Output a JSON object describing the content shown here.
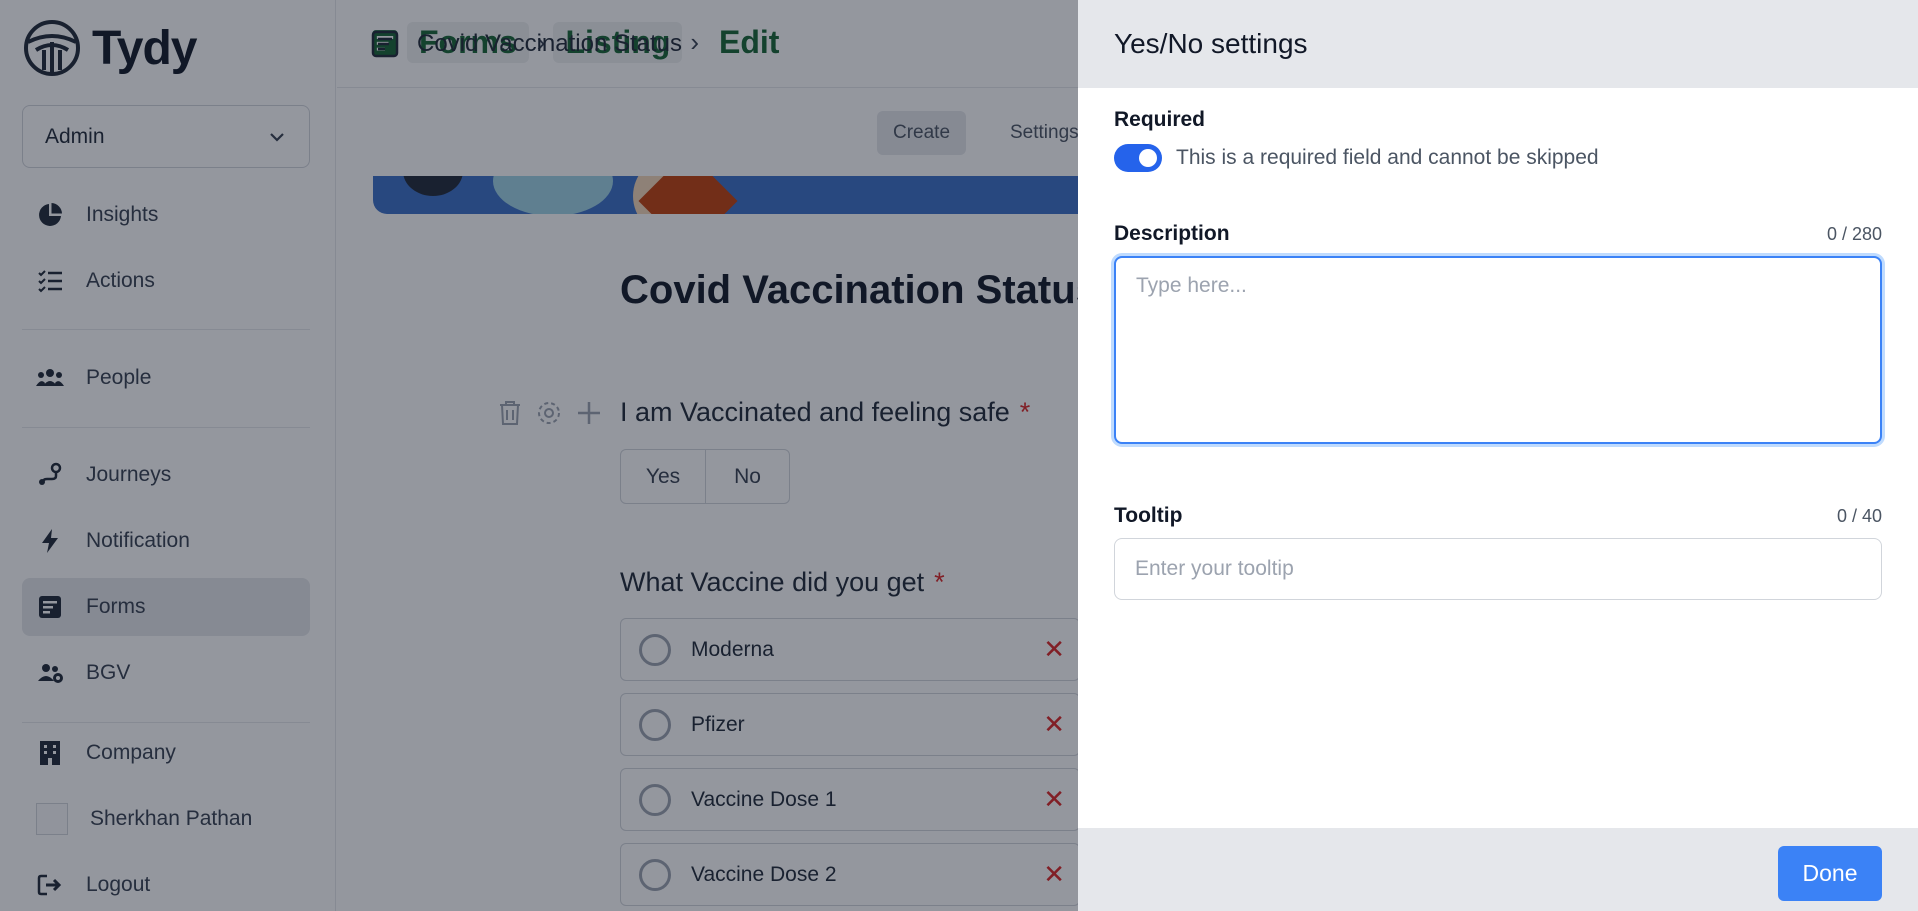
{
  "app": {
    "name": "Tydy"
  },
  "sidebar": {
    "role": "Admin",
    "items": [
      {
        "label": "Insights",
        "icon": "pie-chart-icon"
      },
      {
        "label": "Actions",
        "icon": "checklist-icon"
      },
      {
        "label": "People",
        "icon": "people-icon"
      },
      {
        "label": "Journeys",
        "icon": "route-icon"
      },
      {
        "label": "Notification",
        "icon": "bolt-icon"
      },
      {
        "label": "Forms",
        "icon": "form-icon",
        "active": true
      },
      {
        "label": "BGV",
        "icon": "group-icon"
      },
      {
        "label": "Company",
        "icon": "building-icon"
      },
      {
        "label": "Sherkhan Pathan",
        "icon": "avatar"
      },
      {
        "label": "Logout",
        "icon": "logout-icon"
      }
    ]
  },
  "breadcrumb": {
    "items": [
      "Forms",
      "Listing",
      "Edit"
    ]
  },
  "form_bar": {
    "title": "Covid Vaccination Status",
    "tabs": [
      "Create",
      "Settings"
    ]
  },
  "form": {
    "heading": "Covid Vaccination Status",
    "questions": [
      {
        "label": "I am Vaccinated and feeling safe",
        "required_mark": "*",
        "options": [
          "Yes",
          "No"
        ]
      },
      {
        "label": "What Vaccine did you get",
        "required_mark": "*",
        "options": [
          "Moderna",
          "Pfizer",
          "Vaccine Dose 1",
          "Vaccine Dose 2"
        ]
      }
    ]
  },
  "drawer": {
    "title": "Yes/No settings",
    "required": {
      "label": "Required",
      "enabled": true,
      "text": "This is a required field and cannot be skipped"
    },
    "description": {
      "label": "Description",
      "counter": "0 / 280",
      "placeholder": "Type here...",
      "value": ""
    },
    "tooltip": {
      "label": "Tooltip",
      "counter": "0 / 40",
      "placeholder": "Enter your tooltip",
      "value": ""
    },
    "done_label": "Done"
  },
  "colors": {
    "accent": "#3b82f6",
    "brand_green": "#166534",
    "toggle_on": "#2563eb",
    "danger": "#dc2626"
  }
}
